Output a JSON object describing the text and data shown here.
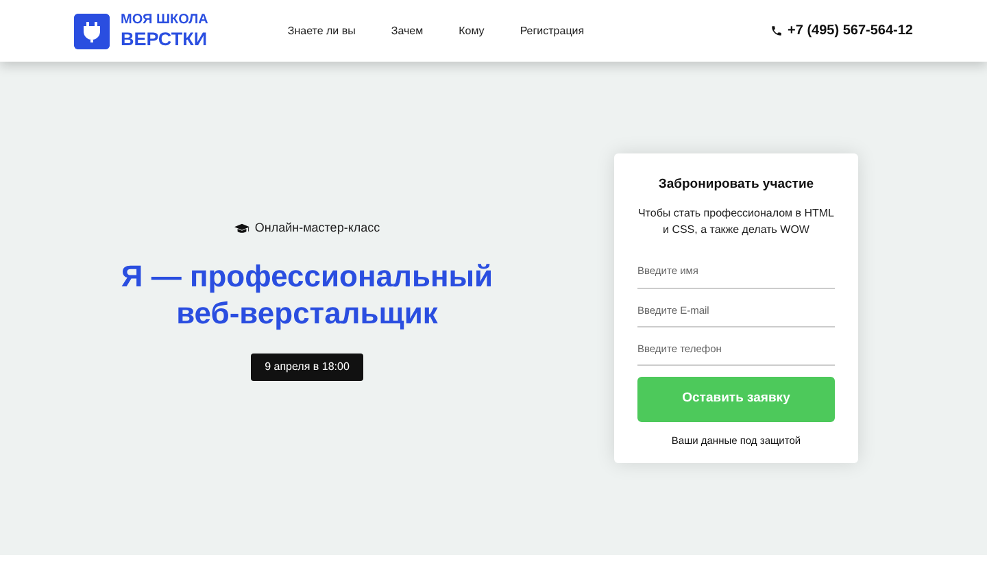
{
  "logo": {
    "line1": "МОЯ ШКОЛА",
    "line2": "ВЕРСТКИ"
  },
  "nav": [
    {
      "label": "Знаете ли вы"
    },
    {
      "label": "Зачем"
    },
    {
      "label": "Кому"
    },
    {
      "label": "Регистрация"
    }
  ],
  "phone": "+7 (495) 567-564-12",
  "hero": {
    "eyebrow": "Онлайн-мастер-класс",
    "title_line1": "Я — профессиональный",
    "title_line2": "веб-верстальщик",
    "date": "9 апреля в 18:00"
  },
  "form": {
    "title": "Забронировать участие",
    "subtitle": "Чтобы стать профессионалом в HTML и CSS, а также делать WOW",
    "fields": [
      {
        "placeholder": "Введите имя"
      },
      {
        "placeholder": "Введите E-mail"
      },
      {
        "placeholder": "Введите телефон"
      }
    ],
    "button": "Оставить заявку",
    "note": "Ваши данные под защитой"
  }
}
